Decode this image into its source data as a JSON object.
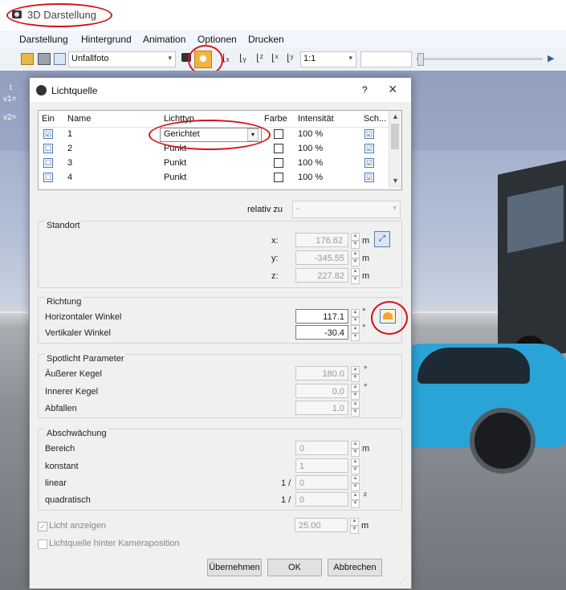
{
  "window": {
    "title": "3D Darstellung"
  },
  "menu": [
    "Darstellung",
    "Hintergrund",
    "Animation",
    "Optionen",
    "Drucken"
  ],
  "toolbar": {
    "view_dropdown": "Unfallfoto",
    "scale_dropdown": "1:1"
  },
  "scene_labels": {
    "t": "t",
    "v1": "v1=",
    "v2": "v2="
  },
  "dialog": {
    "title": "Lichtquelle",
    "help": "?",
    "close": "×",
    "table": {
      "headers": [
        "Ein",
        "Name",
        "Lichttyp",
        "Farbe",
        "Intensität",
        "Sch..."
      ],
      "rows": [
        {
          "ein": "☑",
          "name": "1",
          "typ": "Gerichtet",
          "intensity": "100 %",
          "sch": "☑"
        },
        {
          "ein": "☐",
          "name": "2",
          "typ": "Punkt",
          "intensity": "100 %",
          "sch": "☑"
        },
        {
          "ein": "☐",
          "name": "3",
          "typ": "Punkt",
          "intensity": "100 %",
          "sch": "☑"
        },
        {
          "ein": "☐",
          "name": "4",
          "typ": "Punkt",
          "intensity": "100 %",
          "sch": "☑"
        }
      ]
    },
    "relativ_label": "relativ zu",
    "relativ_value": "-",
    "standort": {
      "title": "Standort",
      "x_label": "x:",
      "x": "176.62",
      "y_label": "y:",
      "y": "-345.55",
      "z_label": "z:",
      "z": "227.82",
      "unit": "m"
    },
    "richtung": {
      "title": "Richtung",
      "h_label": "Horizontaler Winkel",
      "h": "117.1",
      "v_label": "Vertikaler Winkel",
      "v": "-30.4",
      "unit": "°"
    },
    "spot": {
      "title": "Spotlicht Parameter",
      "outer_label": "Äußerer Kegel",
      "outer": "180.0",
      "inner_label": "Innerer Kegel",
      "inner": "0.0",
      "fall_label": "Abfallen",
      "fall": "1.0",
      "unit": "°"
    },
    "abschwaechung": {
      "title": "Abschwächung",
      "bereich_label": "Bereich",
      "bereich": "0",
      "bereich_unit": "m",
      "konstant_label": "konstant",
      "konstant": "1",
      "linear_label": "linear",
      "linear_prefix": "1 /",
      "linear": "0",
      "quad_label": "quadratisch",
      "quad_prefix": "1 /",
      "quad": "0",
      "quad_unit": "²"
    },
    "licht_anzeigen": {
      "label": "Licht anzeigen",
      "value": "25.00",
      "unit": "m"
    },
    "hinter_kamera": {
      "label": "Lichtquelle hinter Kameraposition"
    },
    "buttons": {
      "apply": "Übernehmen",
      "ok": "OK",
      "cancel": "Abbrechen"
    }
  },
  "colors": {
    "annotation_red": "#d4141a",
    "accent_blue": "#2d7fd3",
    "car_blue": "#2aa3d6"
  }
}
